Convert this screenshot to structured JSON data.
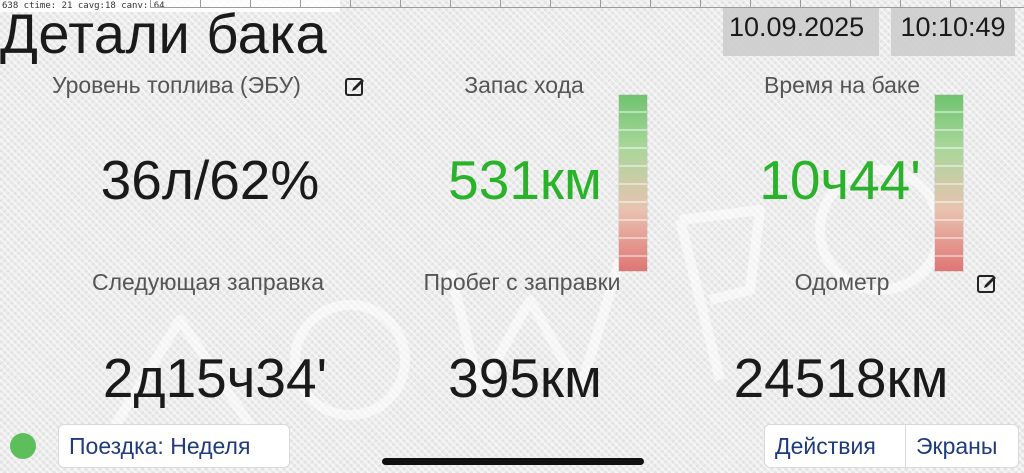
{
  "debug_text": "638 ctime: 21 cavg:18 canv: 64",
  "header": {
    "title": "Детали бака",
    "date": "10.09.2025",
    "time": "10:10:49"
  },
  "metrics": {
    "fuel_level": {
      "label": "Уровень топлива (ЭБУ)",
      "value": "36л/62%"
    },
    "range": {
      "label": "Запас хода",
      "value": "531км",
      "color": "#2ab22a"
    },
    "tank_time": {
      "label": "Время на баке",
      "value": "10ч44'",
      "color": "#2ab22a"
    },
    "next_refuel": {
      "label": "Следующая заправка",
      "value": "2д15ч34'"
    },
    "mileage_since_refuel": {
      "label": "Пробег с заправки",
      "value": "395км"
    },
    "odometer": {
      "label": "Одометр",
      "value": "24518км"
    }
  },
  "icons": {
    "edit": "edit-icon",
    "status": "status-indicator-icon"
  },
  "colors": {
    "accent_green": "#2ab22a",
    "button_text": "#1f3b7a",
    "status_dot": "#5cbf5c"
  },
  "footer": {
    "trip_button": "Поездка: Неделя",
    "actions_button": "Действия",
    "screens_button": "Экраны"
  }
}
